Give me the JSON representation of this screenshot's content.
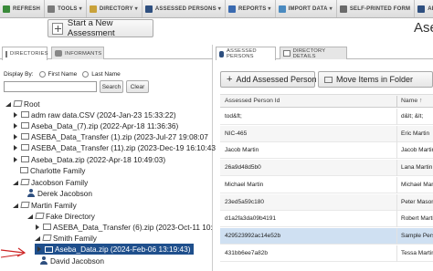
{
  "toolbar": {
    "items": [
      {
        "label": "REFRESH",
        "icon": "refresh-icon",
        "color": "#3a8a3a",
        "caret": false
      },
      {
        "label": "TOOLS",
        "icon": "tools-icon",
        "color": "#7a7a7a",
        "caret": true
      },
      {
        "label": "DIRECTORY",
        "icon": "directory-icon",
        "color": "#c9a23a",
        "caret": true
      },
      {
        "label": "ASSESSED PERSONS",
        "icon": "persons-icon",
        "color": "#2e4f7f",
        "caret": true
      },
      {
        "label": "REPORTS",
        "icon": "reports-icon",
        "color": "#3a6ab0",
        "caret": true
      },
      {
        "label": "IMPORT DATA",
        "icon": "import-icon",
        "color": "#4a8ac0",
        "caret": true
      },
      {
        "label": "SELF-PRINTED FORM",
        "icon": "form-icon",
        "color": "#6a6a6a",
        "caret": false
      },
      {
        "label": "ADMINIS",
        "icon": "admin-icon",
        "color": "#2e4f7f",
        "caret": false
      }
    ]
  },
  "start_button": "Start a New Assessment",
  "page_title": "Ase",
  "left_tabs": {
    "directories": "DIRECTORIES",
    "informants": "INFORMANTS"
  },
  "filter": {
    "display_by": "Display By:",
    "first_name": "First Name",
    "last_name": "Last Name",
    "search_value": "",
    "search_button": "Search",
    "clear_button": "Clear"
  },
  "tree": [
    {
      "label": "Root",
      "type": "folder-open",
      "toggle": "expanded"
    },
    {
      "label": "adm raw data.CSV (2024-Jan-23 15:33:22)",
      "type": "folder",
      "toggle": "collapsed"
    },
    {
      "label": "Aseba_Data_(7).zip (2022-Apr-18 11:36:36)",
      "type": "folder",
      "toggle": "collapsed"
    },
    {
      "label": "ASEBA_Data_Transfer (1).zip (2023-Jul-27 19:08:07",
      "type": "folder",
      "toggle": "collapsed"
    },
    {
      "label": "ASEBA_Data_Transfer (11).zip (2023-Dec-19 16:10:43",
      "type": "folder",
      "toggle": "collapsed"
    },
    {
      "label": "Aseba_Data.zip (2022-Apr-18 10:49:03)",
      "type": "folder",
      "toggle": "collapsed"
    },
    {
      "label": "Charlotte Family",
      "type": "folder",
      "toggle": "none"
    },
    {
      "label": "Jacobson Family",
      "type": "folder-open",
      "toggle": "expanded"
    },
    {
      "label": "Derek Jacobson",
      "type": "person",
      "toggle": "none"
    },
    {
      "label": "Martin Family",
      "type": "folder-open",
      "toggle": "expanded"
    },
    {
      "label": "Fake Directory",
      "type": "folder-open",
      "toggle": "expanded"
    },
    {
      "label": "ASEBA_Data_Transfer (6).zip (2023-Oct-11 10:",
      "type": "folder",
      "toggle": "collapsed"
    },
    {
      "label": "Smith Family",
      "type": "folder-open",
      "toggle": "expanded"
    },
    {
      "label": "Aseba_Data.zip (2024-Feb-06 13:19:43)",
      "type": "folder",
      "toggle": "collapsed",
      "selected": true
    },
    {
      "label": "David Jacobson",
      "type": "person",
      "toggle": "none"
    }
  ],
  "right_tabs": {
    "assessed_persons": "ASSESSED PERSONS",
    "directory_details": "DIRECTORY DETAILS"
  },
  "actions": {
    "add": "Add Assessed Person",
    "move": "Move Items in Folder"
  },
  "grid": {
    "columns": [
      "Assessed Person Id",
      "Name"
    ],
    "rows": [
      {
        "id": "tod&ft;",
        "name": "d&lt; &lt;"
      },
      {
        "id": "NIC-465",
        "name": "Eric Martin"
      },
      {
        "id": "Jacob Martin",
        "name": "Jacob Martin"
      },
      {
        "id": "26a9d48d5b0",
        "name": "Lana Martin"
      },
      {
        "id": "Michael Martin",
        "name": "Michael Martin"
      },
      {
        "id": "23ed5a59c180",
        "name": "Peter Mason"
      },
      {
        "id": "d1a2fa3da09b4191",
        "name": "Robert Martin"
      },
      {
        "id": "429523992ac14e52b",
        "name": "Sample Person",
        "selected": true
      },
      {
        "id": "431bb6ee7a82b",
        "name": "Tessa Martin"
      }
    ]
  },
  "colors": {
    "selection": "#1f4f8c",
    "row_selection": "#cfe0f2",
    "arrow": "#cc2222"
  }
}
